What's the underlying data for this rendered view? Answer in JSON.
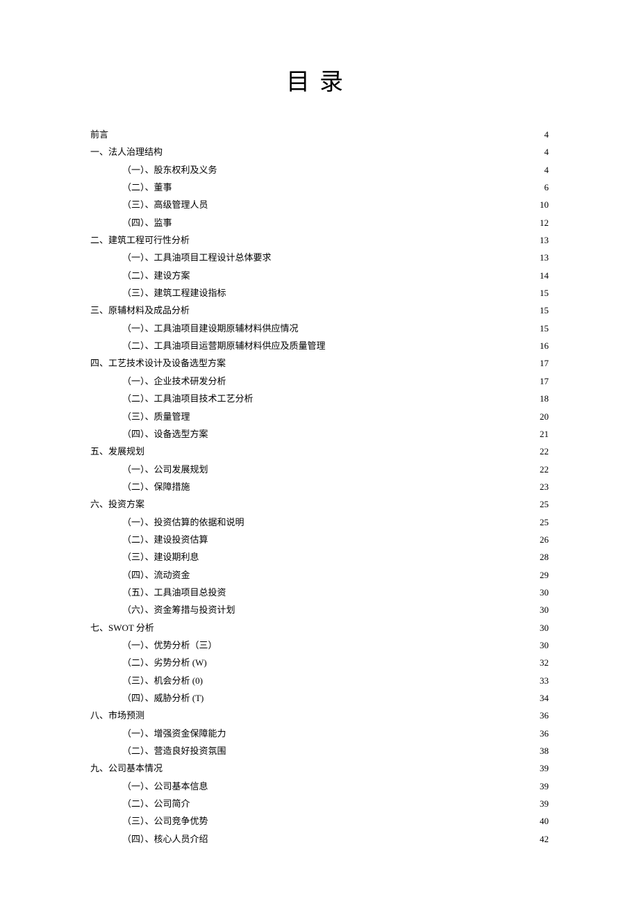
{
  "title": "目录",
  "toc": [
    {
      "level": 1,
      "label": "前言",
      "page": "4"
    },
    {
      "level": 1,
      "label": "一、法人治理结构",
      "page": "4"
    },
    {
      "level": 2,
      "label": "（一）、股东权利及义务",
      "page": "4"
    },
    {
      "level": 2,
      "label": "（二）、董事",
      "page": "6"
    },
    {
      "level": 2,
      "label": "（三）、高级管理人员",
      "page": "10"
    },
    {
      "level": 2,
      "label": "（四）、监事",
      "page": "12"
    },
    {
      "level": 1,
      "label": "二、建筑工程可行性分析",
      "page": "13"
    },
    {
      "level": 2,
      "label": "（一）、工具油项目工程设计总体要求",
      "page": "13"
    },
    {
      "level": 2,
      "label": "（二）、建设方案",
      "page": "14"
    },
    {
      "level": 2,
      "label": "（三）、建筑工程建设指标",
      "page": "15"
    },
    {
      "level": 1,
      "label": "三、原辅材料及成品分析",
      "page": "15"
    },
    {
      "level": 2,
      "label": "（一）、工具油项目建设期原辅材料供应情况",
      "page": "15"
    },
    {
      "level": 2,
      "label": "（二）、工具油项目运营期原辅材料供应及质量管理",
      "page": "16"
    },
    {
      "level": 1,
      "label": "四、工艺技术设计及设备选型方案",
      "page": "17"
    },
    {
      "level": 2,
      "label": "（一）、企业技术研发分析",
      "page": "17"
    },
    {
      "level": 2,
      "label": "（二）、工具油项目技术工艺分析",
      "page": "18"
    },
    {
      "level": 2,
      "label": "（三）、质量管理",
      "page": "20"
    },
    {
      "level": 2,
      "label": "（四）、设备选型方案",
      "page": "21"
    },
    {
      "level": 1,
      "label": "五、发展规划",
      "page": "22"
    },
    {
      "level": 2,
      "label": "（一）、公司发展规划",
      "page": "22"
    },
    {
      "level": 2,
      "label": "（二）、保障措施",
      "page": "23"
    },
    {
      "level": 1,
      "label": "六、投资方案",
      "page": "25"
    },
    {
      "level": 2,
      "label": "（一）、投资估算的依据和说明",
      "page": "25"
    },
    {
      "level": 2,
      "label": "（二）、建设投资估算",
      "page": "26"
    },
    {
      "level": 2,
      "label": "（三）、建设期利息",
      "page": "28"
    },
    {
      "level": 2,
      "label": "（四）、流动资金",
      "page": "29"
    },
    {
      "level": 2,
      "label": "（五）、工具油项目总投资",
      "page": "30"
    },
    {
      "level": 2,
      "label": "（六）、资金筹措与投资计划",
      "page": "30"
    },
    {
      "level": 1,
      "label": "七、SWOT 分析",
      "page": "30"
    },
    {
      "level": 2,
      "label": "（一）、优势分析（三）",
      "page": "30"
    },
    {
      "level": 2,
      "label": "（二）、劣势分析 (W) ",
      "page": "32"
    },
    {
      "level": 2,
      "label": "（三）、机会分析 (0) ",
      "page": "33"
    },
    {
      "level": 2,
      "label": "（四）、威胁分析 (T) ",
      "page": "34"
    },
    {
      "level": 1,
      "label": "八、市场预测",
      "page": "36"
    },
    {
      "level": 2,
      "label": "（一）、增强资金保障能力",
      "page": "36"
    },
    {
      "level": 2,
      "label": "（二）、营造良好投资氛围",
      "page": "38"
    },
    {
      "level": 1,
      "label": "九、公司基本情况",
      "page": "39"
    },
    {
      "level": 2,
      "label": "（一）、公司基本信息",
      "page": "39"
    },
    {
      "level": 2,
      "label": "（二）、公司简介",
      "page": "39"
    },
    {
      "level": 2,
      "label": "（三）、公司竞争优势",
      "page": "40"
    },
    {
      "level": 2,
      "label": "（四）、核心人员介绍",
      "page": "42"
    }
  ]
}
